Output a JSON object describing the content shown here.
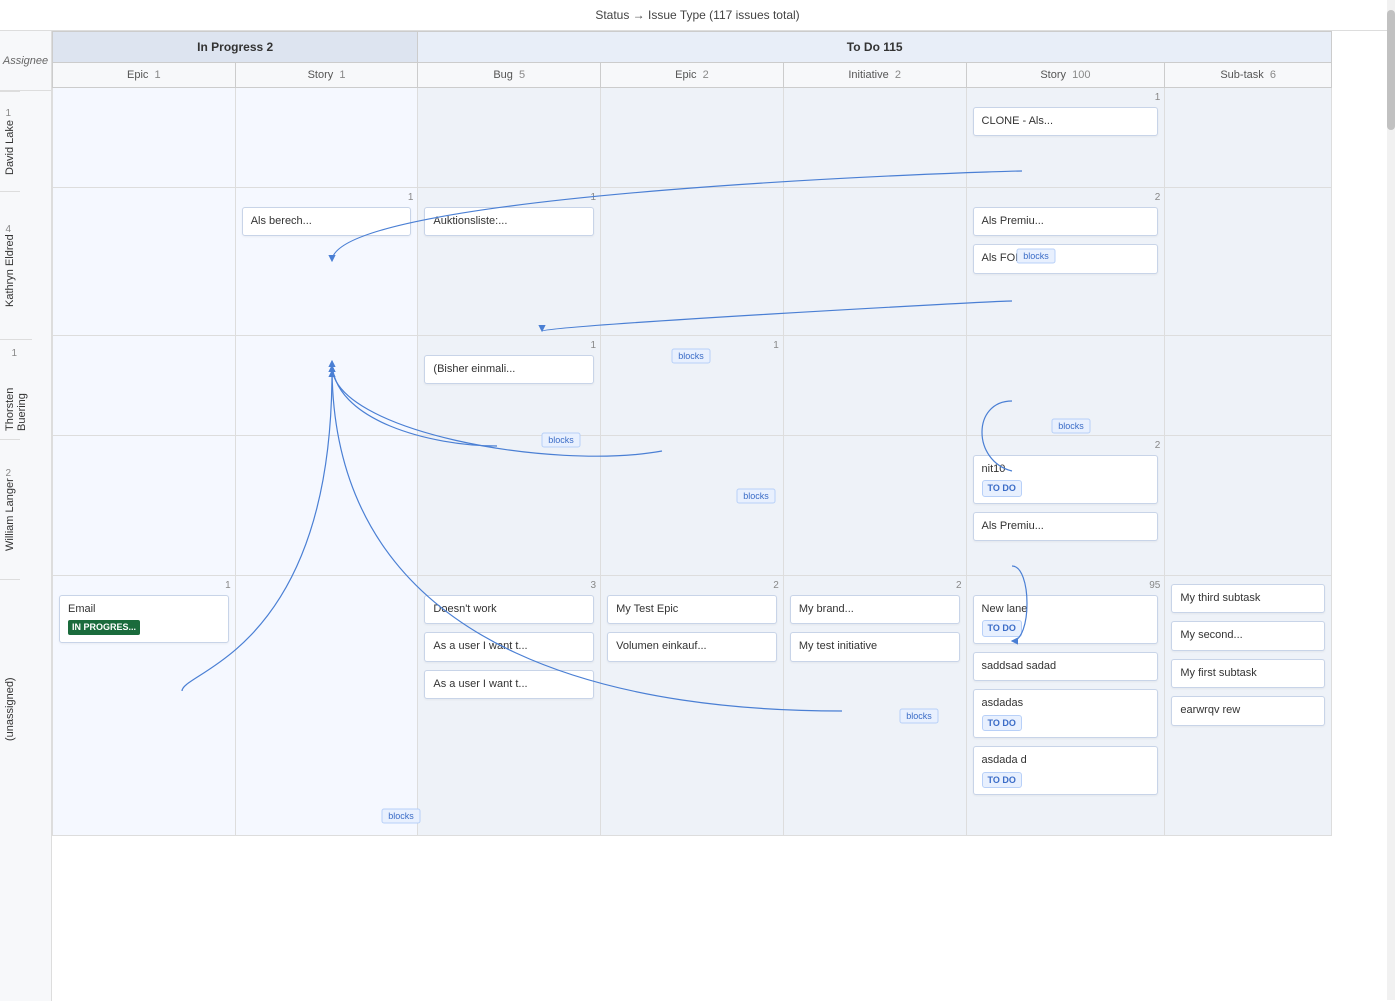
{
  "title": "Status → Issue Type (117 issues total)",
  "assignee_label": "Assignee",
  "headers": {
    "groups": [
      {
        "label": "In Progress",
        "count": "2",
        "cols": 2
      },
      {
        "label": "To Do",
        "count": "115",
        "cols": 5
      }
    ],
    "columns": [
      {
        "label": "Epic",
        "count": "1",
        "group": "in_progress"
      },
      {
        "label": "Story",
        "count": "1",
        "group": "in_progress"
      },
      {
        "label": "Bug",
        "count": "5",
        "group": "todo"
      },
      {
        "label": "Epic",
        "count": "2",
        "group": "todo"
      },
      {
        "label": "Initiative",
        "count": "2",
        "group": "todo"
      },
      {
        "label": "Story",
        "count": "100",
        "group": "todo"
      },
      {
        "label": "Sub-task",
        "count": "6",
        "group": "todo"
      }
    ]
  },
  "assignees": [
    {
      "name": "David Lake",
      "count": "1",
      "cells": {
        "epic_ip": {
          "count": null,
          "cards": []
        },
        "story_ip": {
          "count": null,
          "cards": []
        },
        "bug_todo": {
          "count": null,
          "cards": []
        },
        "epic_todo": {
          "count": null,
          "cards": []
        },
        "initiative_todo": {
          "count": null,
          "cards": []
        },
        "story_todo": {
          "count": "1",
          "cards": [
            {
              "text": "CLONE - Als...",
              "badge": null
            }
          ]
        },
        "subtask_todo": {
          "count": null,
          "cards": []
        }
      }
    },
    {
      "name": "Kathryn Eldred",
      "count": "4",
      "cells": {
        "epic_ip": {
          "count": null,
          "cards": []
        },
        "story_ip": {
          "count": "1",
          "cards": [
            {
              "text": "Als berech...",
              "badge": null
            }
          ]
        },
        "bug_todo": {
          "count": "1",
          "cards": [
            {
              "text": "Auktionsliste:...",
              "badge": null
            }
          ]
        },
        "epic_todo": {
          "count": null,
          "cards": []
        },
        "initiative_todo": {
          "count": null,
          "cards": []
        },
        "story_todo": {
          "count": "2",
          "cards": [
            {
              "text": "Als Premiu...",
              "badge": null
            },
            {
              "text": "Als FOMA...",
              "badge": null
            }
          ]
        },
        "subtask_todo": {
          "count": null,
          "cards": []
        }
      }
    },
    {
      "name": "Thorsten Buering",
      "count": "1",
      "cells": {
        "epic_ip": {
          "count": null,
          "cards": []
        },
        "story_ip": {
          "count": null,
          "cards": []
        },
        "bug_todo": {
          "count": "1",
          "cards": [
            {
              "text": "(Bisher einmali...",
              "badge": null
            }
          ]
        },
        "epic_todo": {
          "count": null,
          "cards": []
        },
        "initiative_todo": {
          "count": null,
          "cards": []
        },
        "story_todo": {
          "count": null,
          "cards": []
        },
        "subtask_todo": {
          "count": null,
          "cards": []
        }
      }
    },
    {
      "name": "William Langer",
      "count": "2",
      "cells": {
        "epic_ip": {
          "count": null,
          "cards": []
        },
        "story_ip": {
          "count": null,
          "cards": []
        },
        "bug_todo": {
          "count": null,
          "cards": []
        },
        "epic_todo": {
          "count": null,
          "cards": []
        },
        "initiative_todo": {
          "count": null,
          "cards": []
        },
        "story_todo": {
          "count": "2",
          "cards": [
            {
              "text": "nit10",
              "badge": "TO DO"
            },
            {
              "text": "Als Premiu...",
              "badge": null
            }
          ]
        },
        "subtask_todo": {
          "count": null,
          "cards": []
        }
      }
    },
    {
      "name": "(unassigned)",
      "count": "",
      "cells": {
        "epic_ip": {
          "count": "1",
          "cards": [
            {
              "text": "Email",
              "badge": "IN PROGRESS"
            }
          ]
        },
        "story_ip": {
          "count": null,
          "cards": []
        },
        "bug_todo": {
          "count": "3",
          "cards": [
            {
              "text": "Doesn't work",
              "badge": null
            },
            {
              "text": "As a user I want t...",
              "badge": null
            },
            {
              "text": "As a user I want t...",
              "badge": null
            }
          ]
        },
        "epic_todo": {
          "count": "2",
          "cards": [
            {
              "text": "My Test Epic",
              "badge": null
            },
            {
              "text": "Volumen einkauf...",
              "badge": null
            }
          ]
        },
        "initiative_todo": {
          "count": "2",
          "cards": [
            {
              "text": "My brand...",
              "badge": null
            },
            {
              "text": "My test initiative",
              "badge": null
            }
          ]
        },
        "story_todo": {
          "count": "95",
          "cards": [
            {
              "text": "New lane",
              "badge": "TO DO"
            },
            {
              "text": "saddsad sadad",
              "badge": null
            },
            {
              "text": "asdadas",
              "badge": "TO DO"
            },
            {
              "text": "asdada d",
              "badge": "TO DO"
            }
          ]
        },
        "subtask_todo": {
          "count": null,
          "cards": [
            {
              "text": "My third subtask",
              "badge": null
            },
            {
              "text": "My second...",
              "badge": null
            },
            {
              "text": "My first subtask",
              "badge": null
            },
            {
              "text": "earwrqv rew",
              "badge": null
            }
          ]
        }
      }
    }
  ],
  "links": [
    {
      "label": "blocks",
      "from": "clone_david",
      "to": "als_bereich"
    },
    {
      "label": "blocks",
      "from": "als_prem_kathryn",
      "to": "auktions"
    },
    {
      "label": "blocks",
      "from": "bisher",
      "to": "als_bereich"
    },
    {
      "label": "blocks",
      "from": "story_unass",
      "to": "als_bereich"
    },
    {
      "label": "blocks",
      "from": "initiative_unass",
      "to": "als_bereich"
    }
  ]
}
